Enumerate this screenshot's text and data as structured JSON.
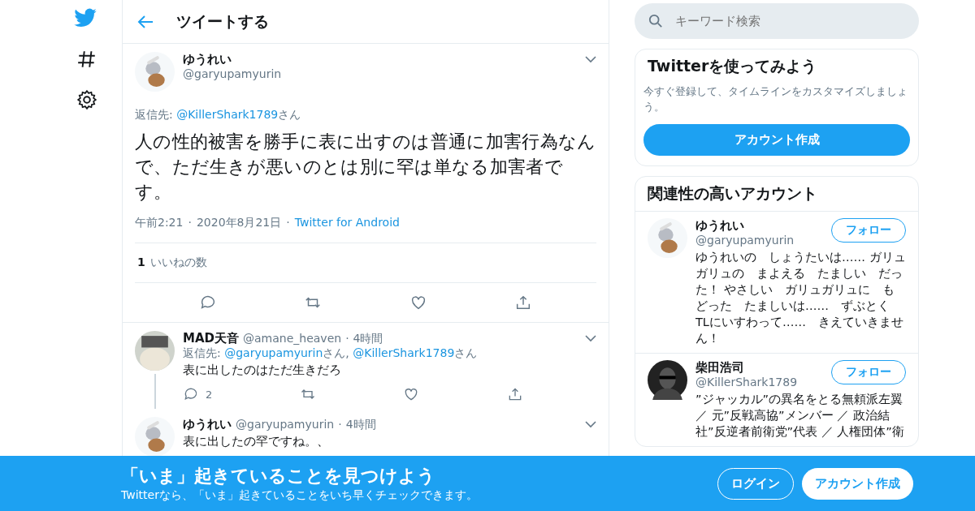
{
  "header": {
    "title": "ツイートする"
  },
  "main_tweet": {
    "name": "ゆうれい",
    "handle": "@garyupamyurin",
    "reply_to": [
      {
        "kind": "plain",
        "text": "返信先: "
      },
      {
        "kind": "link",
        "text": "@KillerShark1789"
      },
      {
        "kind": "plain",
        "text": "さん"
      }
    ],
    "text": "人の性的被害を勝手に表に出すのは普通に加害行為なんで、ただ生きが悪いのとは別に罕は単なる加害者です。",
    "time": "午前2:21",
    "sep": "·",
    "date": "2020年8月21日",
    "source": "Twitter for Android",
    "like_count": "1",
    "like_label": "いいねの数"
  },
  "replies": [
    {
      "name": "MAD天音",
      "handle": "@amane_heaven",
      "sep": "·",
      "time": "4時間",
      "thread_below": true,
      "reply_to": [
        {
          "kind": "plain",
          "text": "返信先: "
        },
        {
          "kind": "link",
          "text": "@garyupamyurin"
        },
        {
          "kind": "plain",
          "text": "さん, "
        },
        {
          "kind": "link",
          "text": "@KillerShark1789"
        },
        {
          "kind": "plain",
          "text": "さん"
        }
      ],
      "text": "表に出したのはただ生きだろ",
      "reply_count": "2"
    },
    {
      "name": "ゆうれい",
      "handle": "@garyupamyurin",
      "sep": "·",
      "time": "4時間",
      "thread_below": false,
      "text": "表に出したの罕ですね。、"
    }
  ],
  "search": {
    "placeholder": "キーワード検索"
  },
  "signup_card": {
    "title": "Twitterを使ってみよう",
    "text": "今すぐ登録して、タイムラインをカスタマイズしましょう。",
    "button": "アカウント作成"
  },
  "related": {
    "title": "関連性の高いアカウント",
    "users": [
      {
        "name": "ゆうれい",
        "handle": "@garyupamyurin",
        "follow": "フォロー",
        "bio": "ゆうれいの　しょうたいは…… ガリュガリュの　まよえる　たましい　だった！ やさしい　ガリュガリュに　もどった　たましいは……　ずぶとく　TLにいすわって……　きえていきません！"
      },
      {
        "name": "柴田浩司",
        "handle": "@KillerShark1789",
        "follow": "フォロー",
        "bio": "”ジャッカル”の異名をとる無頼派左翼／ 元”反戦高協”メンバー ／ 政治結社”反逆者前衛党”代表 ／ 人権団体”衛"
      }
    ]
  },
  "banner": {
    "title": "「いま」起きていることを見つけよう",
    "text": "Twitterなら、「いま」起きていることをいち早くチェックできます。",
    "login": "ログイン",
    "signup": "アカウント作成"
  }
}
